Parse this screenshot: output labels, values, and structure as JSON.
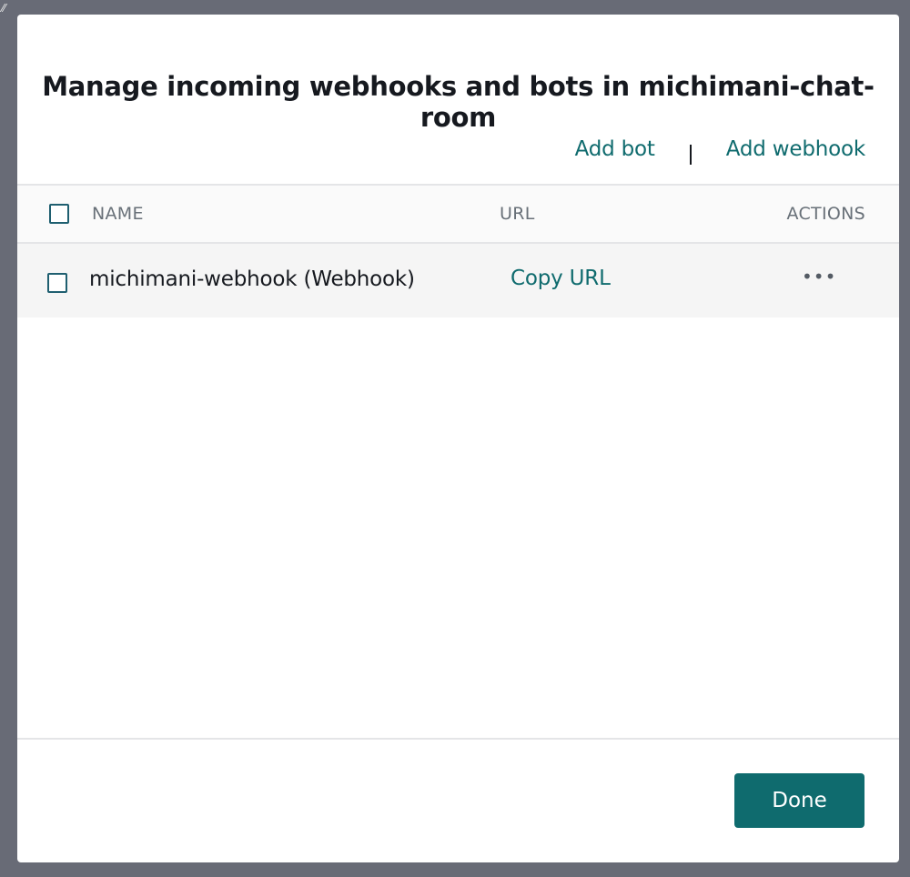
{
  "modal": {
    "title": "Manage incoming webhooks and bots in michimani-chat-room"
  },
  "actions": {
    "add_bot": "Add bot",
    "add_webhook": "Add webhook"
  },
  "table": {
    "columns": [
      "NAME",
      "URL",
      "ACTIONS"
    ],
    "rows": [
      {
        "name": "michimani-webhook (Webhook)",
        "url_action": "Copy URL",
        "actions_icon": "more-horizontal-icon"
      }
    ]
  },
  "footer": {
    "done_label": "Done"
  },
  "colors": {
    "accent": "#0f6b6e",
    "overlay": "#686b76"
  }
}
